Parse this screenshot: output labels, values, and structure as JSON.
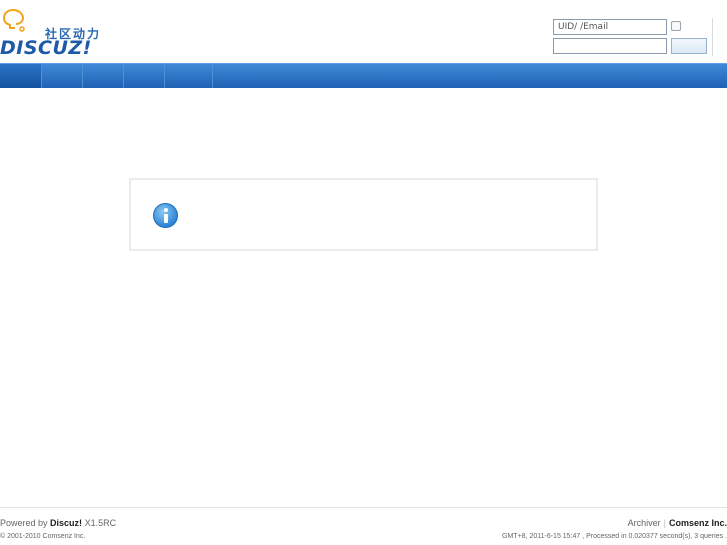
{
  "header": {
    "logo_tagline": "社区动力",
    "logo_wordmark": "DISCUZ!"
  },
  "login": {
    "username_placeholder": "UID/  /Email",
    "password_placeholder": ""
  },
  "footer": {
    "powered_prefix": "Powered by",
    "powered_brand": "Discuz!",
    "powered_version": "X1.5RC",
    "copyright_prefix": "© 2001-2010",
    "copyright_company": "Comsenz Inc.",
    "archiver_link": "Archiver",
    "company_link": "Comsenz Inc.",
    "stats": "GMT+8, 2011-6-15 15:47 , Processed in 0.020377 second(s), 3 queries ."
  },
  "colors": {
    "nav_blue": "#1f62b3",
    "brand_blue": "#1c5aa8",
    "info_icon": "#2b86d6"
  }
}
